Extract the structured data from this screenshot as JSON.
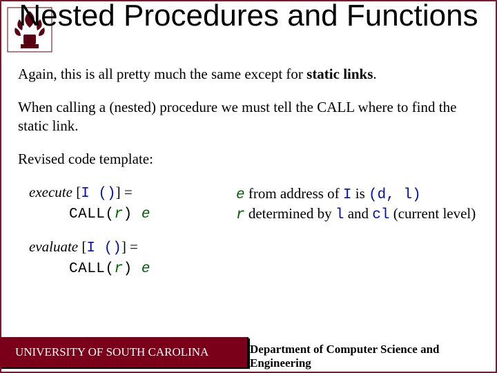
{
  "title": "Nested Procedures and Functions",
  "para1_prefix": "Again, this is all pretty much the same except for ",
  "para1_strong": "static links",
  "para1_suffix": ".",
  "para2": "When calling a (nested) procedure we must tell the CALL where to find the static link.",
  "para3": "Revised code template:",
  "exec_word": "execute",
  "eval_word": "evaluate",
  "bracket_open": " [",
  "code_I": "I",
  "code_parens": " ()",
  "bracket_close_eq": "] =",
  "call_text": "CALL(",
  "call_r": "r",
  "call_close": ") ",
  "call_e": "e",
  "rhs_e": "e",
  "rhs_from": " from address of ",
  "rhs_I": "I",
  "rhs_is": " is ",
  "rhs_pair_open": "(",
  "rhs_d": "d",
  "rhs_comma": ", ",
  "rhs_l": "l",
  "rhs_pair_close": ")",
  "rhs2_r": "r",
  "rhs2_det": " determined by ",
  "rhs2_l": "l",
  "rhs2_and": " and ",
  "rhs2_cl": "cl",
  "rhs2_tail": " (current level)",
  "footer_left": "UNIVERSITY OF SOUTH CAROLINA",
  "footer_right": "Department of Computer Science and Engineering"
}
